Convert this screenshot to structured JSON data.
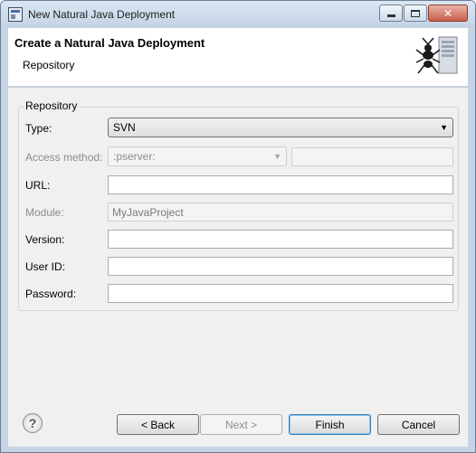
{
  "window": {
    "title": "New Natural Java Deployment"
  },
  "header": {
    "title": "Create a Natural Java Deployment",
    "subtitle": "Repository"
  },
  "group": {
    "title": "Repository"
  },
  "fields": {
    "type_label": "Type:",
    "type_value": "SVN",
    "access_method_label": "Access method:",
    "access_method_value": ":pserver:",
    "access_method_extra": "",
    "url_label": "URL:",
    "url_value": "",
    "module_label": "Module:",
    "module_value": "MyJavaProject",
    "version_label": "Version:",
    "version_value": "",
    "userid_label": "User ID:",
    "userid_value": "",
    "password_label": "Password:",
    "password_value": ""
  },
  "buttons": {
    "back": "< Back",
    "next": "Next >",
    "finish": "Finish",
    "cancel": "Cancel",
    "help": "?"
  },
  "icons": {
    "app": "window-app-icon",
    "ant": "ant-server-icon",
    "help": "help-icon"
  }
}
